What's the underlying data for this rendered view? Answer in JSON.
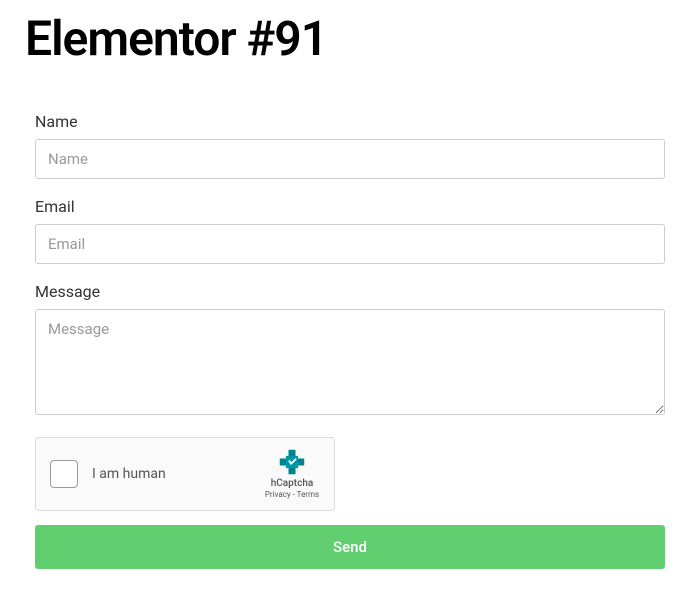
{
  "title": "Elementor #91",
  "form": {
    "name": {
      "label": "Name",
      "placeholder": "Name"
    },
    "email": {
      "label": "Email",
      "placeholder": "Email"
    },
    "message": {
      "label": "Message",
      "placeholder": "Message"
    },
    "captcha": {
      "text": "I am human",
      "brand": "hCaptcha",
      "links": "Privacy - Terms"
    },
    "submit_label": "Send"
  },
  "colors": {
    "submit_bg": "#61ce70",
    "submit_text": "#ffffff"
  }
}
